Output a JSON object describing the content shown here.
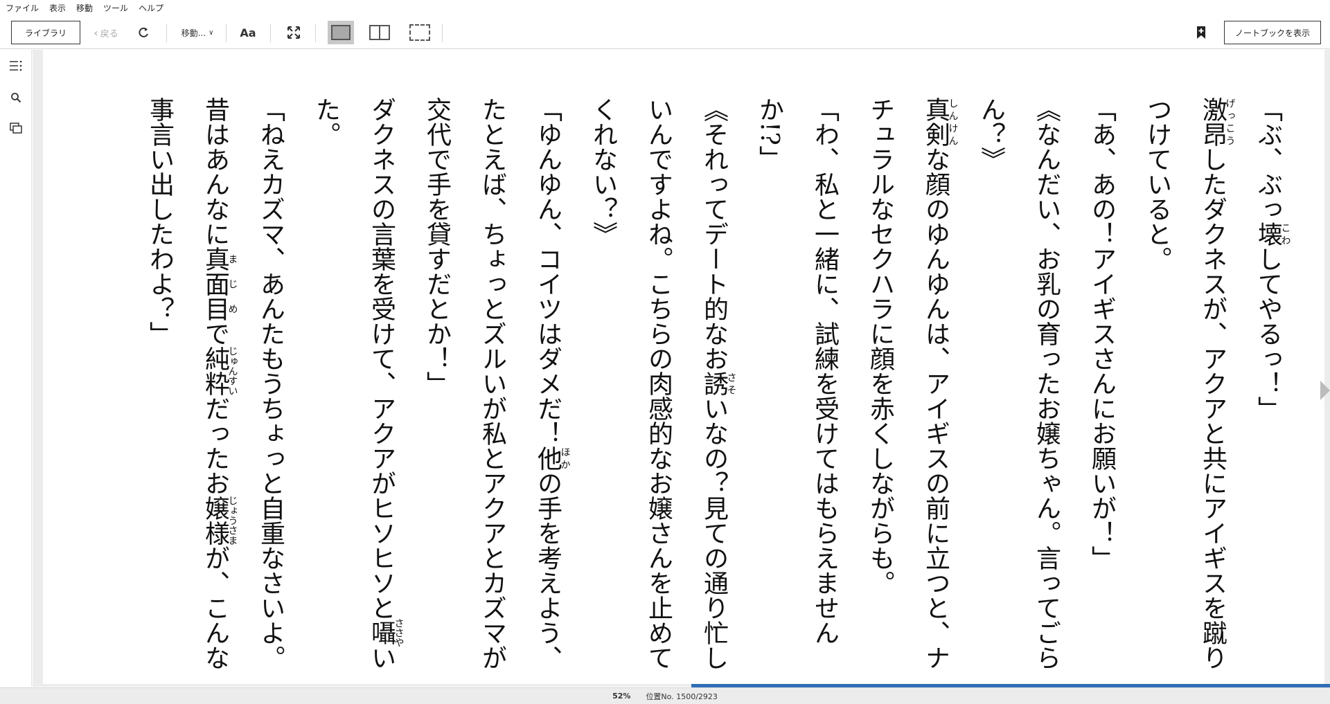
{
  "menubar": {
    "items": [
      "ファイル",
      "表示",
      "移動",
      "ツール",
      "ヘルプ"
    ]
  },
  "toolbar": {
    "library_label": "ライブラリ",
    "back_label": "戻る",
    "goto_label": "移動...",
    "font_label": "Aa",
    "notebook_label": "ノートブックを表示",
    "icons": {
      "refresh": "refresh-icon",
      "fullscreen": "fullscreen-icon",
      "single_page": "single-page-view-icon",
      "double_page": "double-page-view-icon",
      "scroll": "continuous-scroll-icon",
      "bookmark": "bookmark-add-icon"
    }
  },
  "rail": {
    "icons": [
      "toc-icon",
      "search-icon",
      "flashcards-icon"
    ]
  },
  "book": {
    "lines": [
      {
        "text": "「ぶ、ぶっ壊してやるっ！」",
        "ruby": [
          {
            "base": "壊",
            "rt": "こわ"
          }
        ]
      },
      {
        "text": "激昂したダクネスが、アクアと共にアイギスを蹴りつけていると。",
        "ruby": [
          {
            "base": "激昂",
            "rt": "げっこう"
          }
        ]
      },
      {
        "text": "「あ、あの！アイギスさんにお願いが！」",
        "ruby": []
      },
      {
        "text": "《なんだい、お乳の育ったお嬢ちゃん。言ってごらん？》",
        "ruby": []
      },
      {
        "text": "真剣な顔のゆんゆんは、アイギスの前に立つと、ナチュラルなセクハラに顔を赤くしながらも。",
        "ruby": [
          {
            "base": "真剣",
            "rt": "しんけん"
          }
        ]
      },
      {
        "text": "「わ、私と一緒に、試練を受けてはもらえませんか!?」",
        "ruby": []
      },
      {
        "text": "《それってデート的なお誘いなの？見ての通り忙しいんですよね。こちらの肉感的なお嬢さんを止めてくれない？》",
        "ruby": [
          {
            "base": "誘",
            "rt": "さそ"
          }
        ]
      },
      {
        "text": "「ゆんゆん、コイツはダメだ！他の手を考えよう、たとえば、ちょっとズルいが私とアクアとカズマが交代で手を貸すだとか！」",
        "ruby": [
          {
            "base": "他",
            "rt": "ほか"
          }
        ]
      },
      {
        "text": "ダクネスの言葉を受けて、アクアがヒソヒソと囁いた。",
        "ruby": [
          {
            "base": "囁",
            "rt": "ささや"
          }
        ]
      },
      {
        "text": "「ねえカズマ、あんたもうちょっと自重なさいよ。昔はあんなに真面目で純粋だったお嬢様が、こんな事言い出したわよ？」",
        "ruby": [
          {
            "base": "真面目",
            "rt": "まじめ"
          },
          {
            "base": "純粋",
            "rt": "じゅんすい"
          },
          {
            "base": "嬢様",
            "rt": "じょうさま"
          }
        ]
      }
    ]
  },
  "status": {
    "percent": "52%",
    "position": "位置No. 1500/2923",
    "progress": 0.52
  },
  "colors": {
    "accent": "#2f6db6",
    "toolbar_bg": "#ffffff",
    "page_bg": "#ececec"
  }
}
